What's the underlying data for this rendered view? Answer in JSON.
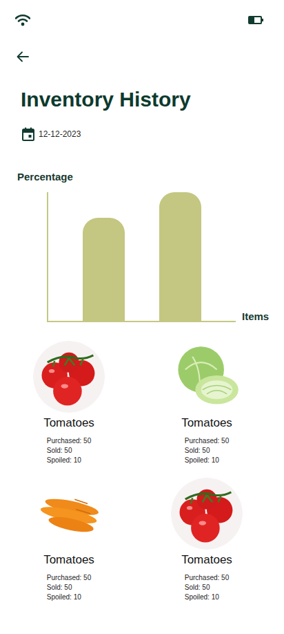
{
  "status_bar": {
    "battery_level": 0.5
  },
  "screen": {
    "title": "Inventory History",
    "date": "12-12-2023"
  },
  "chart": {
    "y_axis_label": "Percentage",
    "x_axis_label": "Items",
    "series": [
      {
        "values": [
          80,
          100
        ]
      }
    ]
  },
  "items": [
    {
      "kind": "tomato",
      "name": "Tomatoes",
      "stats": [
        "Purchased: 50",
        "Sold: 50",
        "Spoiled: 10"
      ]
    },
    {
      "kind": "cabbage",
      "name": "Tomatoes",
      "stats": [
        "Purchased: 50",
        "Sold: 50",
        "Spoiled: 10"
      ]
    },
    {
      "kind": "carrot",
      "name": "Tomatoes",
      "stats": [
        "Purchased: 50",
        "Sold: 50",
        "Spoiled: 10"
      ]
    },
    {
      "kind": "tomato",
      "name": "Tomatoes",
      "stats": [
        "Purchased: 50",
        "Sold: 50",
        "Spoiled: 10"
      ]
    }
  ]
}
